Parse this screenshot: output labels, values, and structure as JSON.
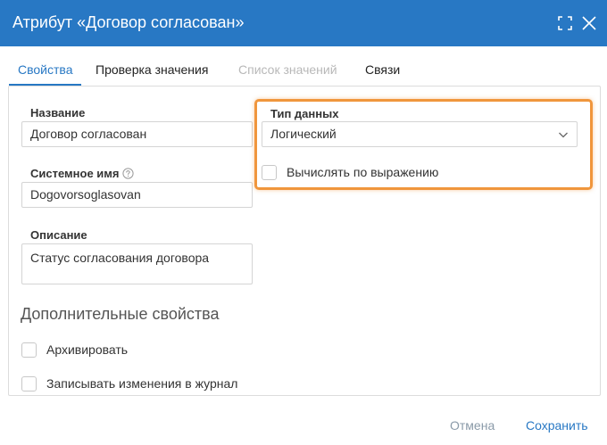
{
  "dialog": {
    "title": "Атрибут «Договор согласован»",
    "icons": {
      "expand": "expand-icon",
      "close": "close-icon"
    }
  },
  "tabs": [
    {
      "label": "Свойства",
      "state": "active"
    },
    {
      "label": "Проверка значения",
      "state": "normal"
    },
    {
      "label": "Список значений",
      "state": "disabled"
    },
    {
      "label": "Связи",
      "state": "normal"
    }
  ],
  "form": {
    "name": {
      "label": "Название",
      "value": "Договор согласован"
    },
    "system_name": {
      "label": "Системное имя",
      "value": "Dogovorsoglasovan",
      "help_icon": "question-circle-icon"
    },
    "description": {
      "label": "Описание",
      "value": "Статус согласования договора"
    },
    "data_type": {
      "label": "Тип данных",
      "value": "Логический"
    },
    "compute_by_expression": {
      "label": "Вычислять по выражению",
      "checked": false
    }
  },
  "additional": {
    "title": "Дополнительные свойства",
    "archive": {
      "label": "Архивировать",
      "checked": false
    },
    "log_changes": {
      "label": "Записывать изменения в журнал",
      "checked": false
    }
  },
  "footer": {
    "cancel_label": "Отмена",
    "save_label": "Сохранить"
  },
  "colors": {
    "header": "#2878c4",
    "accent": "#2878c4",
    "highlight": "#f0963c"
  }
}
